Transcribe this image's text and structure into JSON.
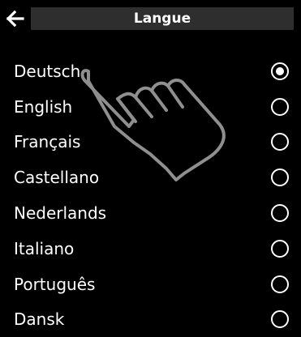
{
  "header": {
    "title": "Langue",
    "back_icon": "arrow-left-icon"
  },
  "languages": [
    {
      "label": "Deutsch",
      "selected": true
    },
    {
      "label": "English",
      "selected": false
    },
    {
      "label": "Français",
      "selected": false
    },
    {
      "label": "Castellano",
      "selected": false
    },
    {
      "label": "Nederlands",
      "selected": false
    },
    {
      "label": "Italiano",
      "selected": false
    },
    {
      "label": "Português",
      "selected": false
    },
    {
      "label": "Dansk",
      "selected": false
    }
  ],
  "overlay": {
    "icon": "pointing-hand-icon"
  }
}
